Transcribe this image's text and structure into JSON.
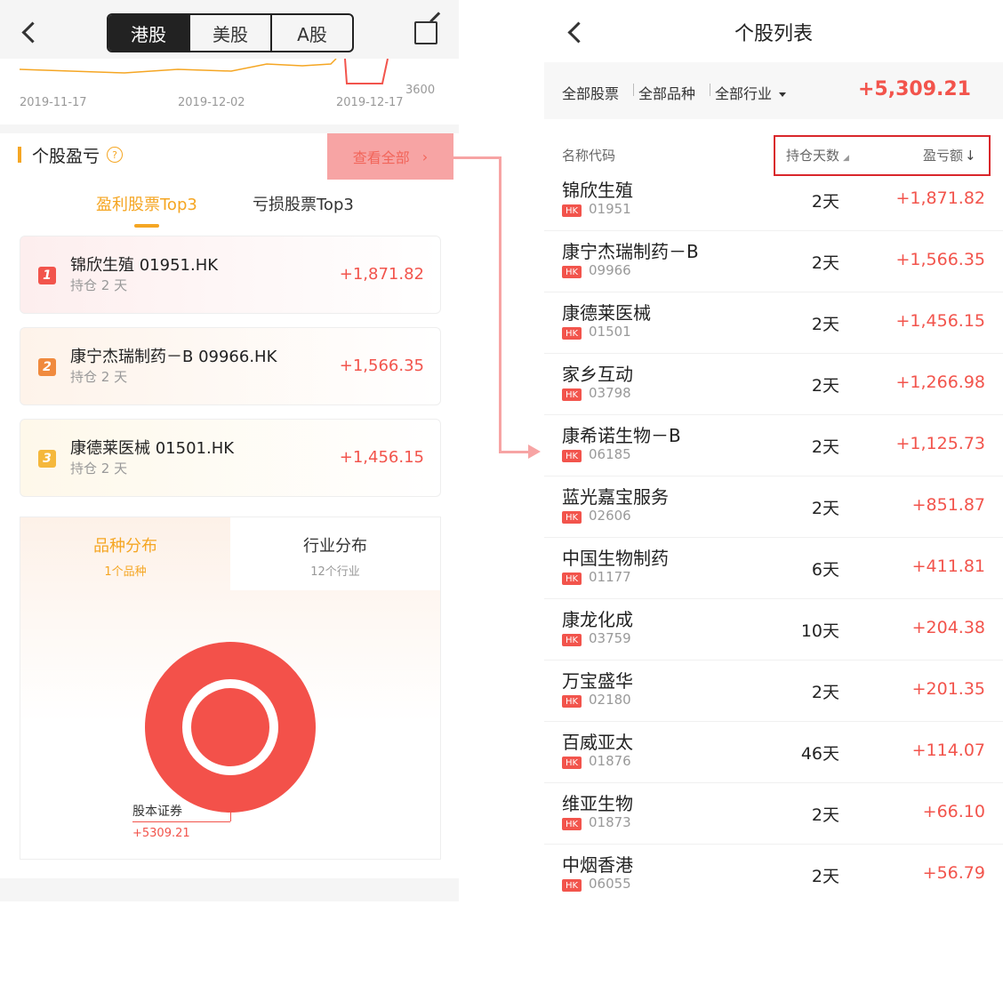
{
  "left": {
    "market_tabs": [
      "港股",
      "美股",
      "A股"
    ],
    "chart": {
      "dates": [
        "2019-11-17",
        "2019-12-02",
        "2019-12-17"
      ],
      "y_label": "3600"
    },
    "section_title": "个股盈亏",
    "help_icon": "?",
    "view_all": "查看全部",
    "subtabs": [
      "盈利股票Top3",
      "亏损股票Top3"
    ],
    "top3": [
      {
        "rank": "1",
        "name": "锦欣生殖 01951.HK",
        "hold": "持仓 2 天",
        "profit": "+1,871.82",
        "color": "#f2544c"
      },
      {
        "rank": "2",
        "name": "康宁杰瑞制药－B 09966.HK",
        "hold": "持仓 2 天",
        "profit": "+1,566.35",
        "color": "#f08a3e"
      },
      {
        "rank": "3",
        "name": "康德莱医械 01501.HK",
        "hold": "持仓 2 天",
        "profit": "+1,456.15",
        "color": "#f5b83c"
      }
    ],
    "dist_tabs": [
      {
        "title": "品种分布",
        "sub": "1个品种"
      },
      {
        "title": "行业分布",
        "sub": "12个行业"
      }
    ],
    "donut_label": {
      "name": "股本证券",
      "value": "+5309.21"
    }
  },
  "right": {
    "title": "个股列表",
    "filters": [
      "全部股票",
      "全部品种",
      "全部行业"
    ],
    "total": "+5,309.21",
    "columns": {
      "name": "名称代码",
      "days": "持仓天数",
      "profit": "盈亏额"
    },
    "hk_badge": "HK",
    "rows": [
      {
        "name": "锦欣生殖",
        "code": "01951",
        "days": "2天",
        "profit": "+1,871.82"
      },
      {
        "name": "康宁杰瑞制药－B",
        "code": "09966",
        "days": "2天",
        "profit": "+1,566.35"
      },
      {
        "name": "康德莱医械",
        "code": "01501",
        "days": "2天",
        "profit": "+1,456.15"
      },
      {
        "name": "家乡互动",
        "code": "03798",
        "days": "2天",
        "profit": "+1,266.98"
      },
      {
        "name": "康希诺生物－B",
        "code": "06185",
        "days": "2天",
        "profit": "+1,125.73"
      },
      {
        "name": "蓝光嘉宝服务",
        "code": "02606",
        "days": "2天",
        "profit": "+851.87"
      },
      {
        "name": "中国生物制药",
        "code": "01177",
        "days": "6天",
        "profit": "+411.81"
      },
      {
        "name": "康龙化成",
        "code": "03759",
        "days": "10天",
        "profit": "+204.38"
      },
      {
        "name": "万宝盛华",
        "code": "02180",
        "days": "2天",
        "profit": "+201.35"
      },
      {
        "name": "百威亚太",
        "code": "01876",
        "days": "46天",
        "profit": "+114.07"
      },
      {
        "name": "维亚生物",
        "code": "01873",
        "days": "2天",
        "profit": "+66.10"
      },
      {
        "name": "中烟香港",
        "code": "06055",
        "days": "2天",
        "profit": "+56.79"
      }
    ]
  }
}
